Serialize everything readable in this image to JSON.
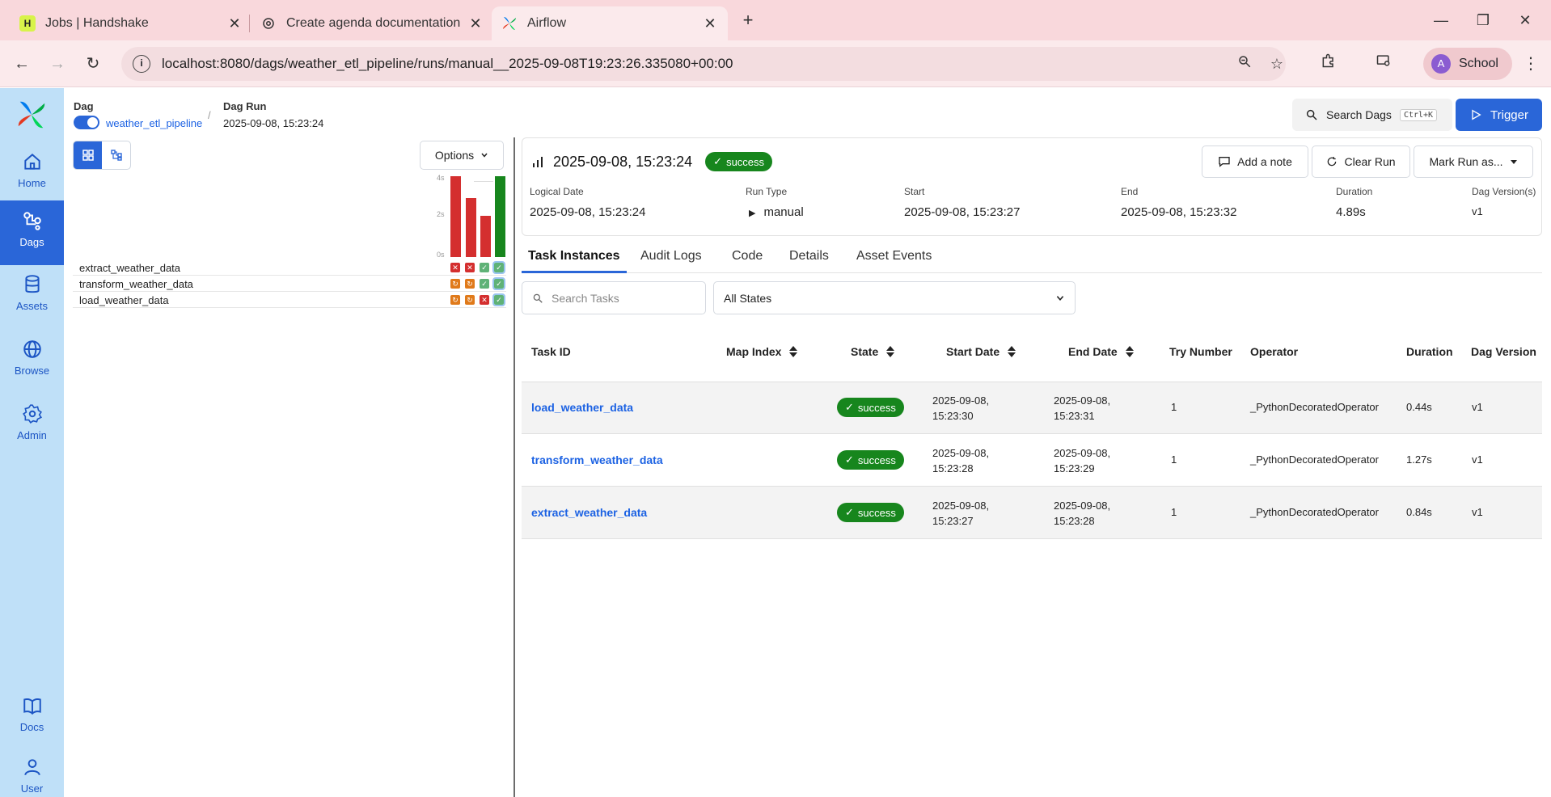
{
  "browser": {
    "tabs": [
      {
        "title": "Jobs | Handshake",
        "favicon": "handshake-icon"
      },
      {
        "title": "Create agenda documentation",
        "favicon": "openai-icon"
      },
      {
        "title": "Airflow",
        "favicon": "airflow-icon"
      }
    ],
    "url": "localhost:8080/dags/weather_etl_pipeline/runs/manual__2025-09-08T19:23:26.335080+00:00",
    "profile": {
      "initial": "A",
      "name": "School"
    }
  },
  "sidebar": {
    "items": [
      {
        "label": "Home",
        "icon": "home-icon"
      },
      {
        "label": "Dags",
        "icon": "dags-icon"
      },
      {
        "label": "Assets",
        "icon": "database-icon"
      },
      {
        "label": "Browse",
        "icon": "globe-icon"
      },
      {
        "label": "Admin",
        "icon": "gear-icon"
      },
      {
        "label": "Docs",
        "icon": "book-icon"
      },
      {
        "label": "User",
        "icon": "user-icon"
      }
    ]
  },
  "breadcrumb": {
    "dag_label": "Dag",
    "dag_value": "weather_etl_pipeline",
    "run_label": "Dag Run",
    "run_value": "2025-09-08, 15:23:24"
  },
  "header": {
    "search_label": "Search Dags",
    "search_shortcut": "Ctrl+K",
    "trigger_label": "Trigger"
  },
  "grid": {
    "options_label": "Options",
    "axis": [
      "4s",
      "2s",
      "0s"
    ],
    "run_durations_s": [
      4.1,
      3.0,
      2.1,
      4.1
    ],
    "run_colors": [
      "#d42f2f",
      "#d42f2f",
      "#d42f2f",
      "#17861d"
    ],
    "tasks": [
      {
        "name": "extract_weather_data",
        "states": [
          "failed",
          "failed",
          "success",
          "success"
        ]
      },
      {
        "name": "transform_weather_data",
        "states": [
          "up_for_retry",
          "up_for_retry",
          "success",
          "success"
        ]
      },
      {
        "name": "load_weather_data",
        "states": [
          "up_for_retry",
          "up_for_retry",
          "failed",
          "success"
        ]
      }
    ]
  },
  "run": {
    "title": "2025-09-08, 15:23:24",
    "state": "success",
    "add_note_label": "Add a note",
    "clear_run_label": "Clear Run",
    "mark_run_label": "Mark Run as...",
    "meta": [
      {
        "label": "Logical Date",
        "value": "2025-09-08, 15:23:24"
      },
      {
        "label": "Run Type",
        "value": "manual"
      },
      {
        "label": "Start",
        "value": "2025-09-08, 15:23:27"
      },
      {
        "label": "End",
        "value": "2025-09-08, 15:23:32"
      },
      {
        "label": "Duration",
        "value": "4.89s"
      },
      {
        "label": "Dag Version(s)",
        "value": "v1"
      }
    ]
  },
  "detail_tabs": [
    "Task Instances",
    "Audit Logs",
    "Code",
    "Details",
    "Asset Events"
  ],
  "filters": {
    "search_placeholder": "Search Tasks",
    "state_value": "All States"
  },
  "table": {
    "columns": [
      "Task ID",
      "Map Index",
      "State",
      "Start Date",
      "End Date",
      "Try Number",
      "Operator",
      "Duration",
      "Dag Version"
    ],
    "rows": [
      {
        "task_id": "load_weather_data",
        "state": "success",
        "start_date": "2025-09-08,",
        "start_time": "15:23:30",
        "end_date": "2025-09-08,",
        "end_time": "15:23:31",
        "try_number": "1",
        "operator": "_PythonDecoratedOperator",
        "duration": "0.44s",
        "dag_version": "v1"
      },
      {
        "task_id": "transform_weather_data",
        "state": "success",
        "start_date": "2025-09-08,",
        "start_time": "15:23:28",
        "end_date": "2025-09-08,",
        "end_time": "15:23:29",
        "try_number": "1",
        "operator": "_PythonDecoratedOperator",
        "duration": "1.27s",
        "dag_version": "v1"
      },
      {
        "task_id": "extract_weather_data",
        "state": "success",
        "start_date": "2025-09-08,",
        "start_time": "15:23:27",
        "end_date": "2025-09-08,",
        "end_time": "15:23:28",
        "try_number": "1",
        "operator": "_PythonDecoratedOperator",
        "duration": "0.84s",
        "dag_version": "v1"
      }
    ]
  },
  "colors": {
    "accent": "#2a66d8",
    "sidebar_bg": "#bfe0f8",
    "success": "#17861d",
    "failed": "#d42f2f",
    "retry": "#e07a1a",
    "tabbar_bg": "#f9d8dc"
  }
}
